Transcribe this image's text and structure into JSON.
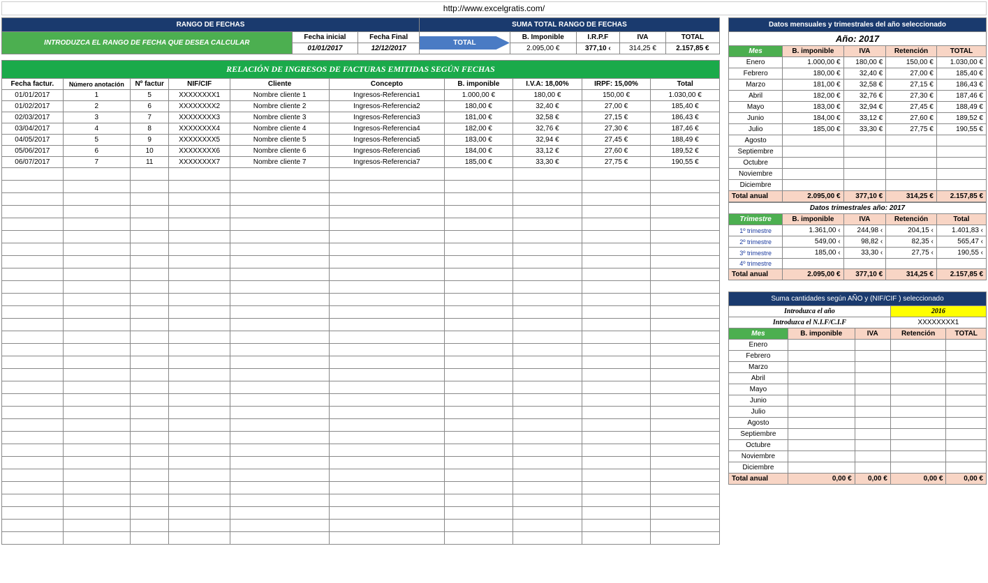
{
  "url": "http://www.excelgratis.com/",
  "rangeSection": {
    "title": "RANGO DE FECHAS",
    "instruction": "INTRODUZCA EL RANGO DE FECHA QUE DESEA CALCULAR",
    "startLabel": "Fecha inicial",
    "endLabel": "Fecha Final",
    "startDate": "01/01/2017",
    "endDate": "12/12/2017",
    "totalLabel": "TOTAL"
  },
  "sumaSection": {
    "title": "SUMA TOTAL RANGO DE FECHAS",
    "headers": [
      "B. Imponible",
      "I.R.P.F",
      "IVA",
      "TOTAL"
    ],
    "values": [
      "2.095,00 €",
      "377,10 ‹",
      "314,25 €",
      "2.157,85 €"
    ]
  },
  "mainTable": {
    "title": "RELACIÓN DE INGRESOS DE FACTURAS EMITIDAS SEGÚN FECHAS",
    "headers": [
      "Fecha factur.",
      "Número anotación",
      "Nº factur",
      "NIF/CIF",
      "Cliente",
      "Concepto",
      "B. imponible",
      "I.V.A: 18,00%",
      "IRPF: 15,00%",
      "Total"
    ],
    "rows": [
      [
        "01/01/2017",
        "1",
        "5",
        "XXXXXXXX1",
        "Nombre cliente 1",
        "Ingresos-Referencia1",
        "1.000,00 €",
        "180,00 €",
        "150,00 €",
        "1.030,00 €"
      ],
      [
        "01/02/2017",
        "2",
        "6",
        "XXXXXXXX2",
        "Nombre cliente 2",
        "Ingresos-Referencia2",
        "180,00 €",
        "32,40 €",
        "27,00 €",
        "185,40 €"
      ],
      [
        "02/03/2017",
        "3",
        "7",
        "XXXXXXXX3",
        "Nombre cliente 3",
        "Ingresos-Referencia3",
        "181,00 €",
        "32,58 €",
        "27,15 €",
        "186,43 €"
      ],
      [
        "03/04/2017",
        "4",
        "8",
        "XXXXXXXX4",
        "Nombre cliente 4",
        "Ingresos-Referencia4",
        "182,00 €",
        "32,76 €",
        "27,30 €",
        "187,46 €"
      ],
      [
        "04/05/2017",
        "5",
        "9",
        "XXXXXXXX5",
        "Nombre cliente 5",
        "Ingresos-Referencia5",
        "183,00 €",
        "32,94 €",
        "27,45 €",
        "188,49 €"
      ],
      [
        "05/06/2017",
        "6",
        "10",
        "XXXXXXXX6",
        "Nombre cliente 6",
        "Ingresos-Referencia6",
        "184,00 €",
        "33,12 €",
        "27,60 €",
        "189,52 €"
      ],
      [
        "06/07/2017",
        "7",
        "11",
        "XXXXXXXX7",
        "Nombre cliente 7",
        "Ingresos-Referencia7",
        "185,00 €",
        "33,30 €",
        "27,75 €",
        "190,55 €"
      ]
    ],
    "emptyRows": 30
  },
  "monthlyPanel": {
    "title": "Datos mensuales y trimestrales del año seleccionado",
    "yearLabel": "Año:  2017",
    "headers": [
      "Mes",
      "B. imponible",
      "IVA",
      "Retención",
      "TOTAL"
    ],
    "rows": [
      [
        "Enero",
        "1.000,00 €",
        "180,00 €",
        "150,00 €",
        "1.030,00 €"
      ],
      [
        "Febrero",
        "180,00 €",
        "32,40 €",
        "27,00 €",
        "185,40 €"
      ],
      [
        "Marzo",
        "181,00 €",
        "32,58 €",
        "27,15 €",
        "186,43 €"
      ],
      [
        "Abril",
        "182,00 €",
        "32,76 €",
        "27,30 €",
        "187,46 €"
      ],
      [
        "Mayo",
        "183,00 €",
        "32,94 €",
        "27,45 €",
        "188,49 €"
      ],
      [
        "Junio",
        "184,00 €",
        "33,12 €",
        "27,60 €",
        "189,52 €"
      ],
      [
        "Julio",
        "185,00 €",
        "33,30 €",
        "27,75 €",
        "190,55 €"
      ],
      [
        "Agosto",
        "",
        "",
        "",
        ""
      ],
      [
        "Septiembre",
        "",
        "",
        "",
        ""
      ],
      [
        "Octubre",
        "",
        "",
        "",
        ""
      ],
      [
        "Noviembre",
        "",
        "",
        "",
        ""
      ],
      [
        "Diciembre",
        "",
        "",
        "",
        ""
      ]
    ],
    "totalLabel": "Total anual",
    "totals": [
      "2.095,00 €",
      "377,10 €",
      "314,25 €",
      "2.157,85 €"
    ]
  },
  "quarterlyPanel": {
    "title": "Datos trimestrales año: 2017",
    "headers": [
      "Trimestre",
      "B. imponible",
      "IVA",
      "Retención",
      "Total"
    ],
    "rows": [
      [
        "1º trimestre",
        "1.361,00 ‹",
        "244,98 ‹",
        "204,15 ‹",
        "1.401,83 ‹"
      ],
      [
        "2º trimestre",
        "549,00 ‹",
        "98,82 ‹",
        "82,35 ‹",
        "565,47 ‹"
      ],
      [
        "3º trimestre",
        "185,00 ‹",
        "33,30 ‹",
        "27,75 ‹",
        "190,55 ‹"
      ],
      [
        "4º trimestre",
        "",
        "",
        "",
        ""
      ]
    ],
    "totalLabel": "Total anual",
    "totals": [
      "2.095,00 €",
      "377,10 €",
      "314,25 €",
      "2.157,85 €"
    ]
  },
  "nifPanel": {
    "title": "Suma cantidades según AÑO y (NIF/CIF ) seleccionado",
    "yearLabel": "Introduzca el año",
    "yearValue": "2016",
    "nifLabel": "Introduzca el N.I.F/C.I.F",
    "nifValue": "XXXXXXXX1",
    "headers": [
      "Mes",
      "B. imponible",
      "IVA",
      "Retención",
      "TOTAL"
    ],
    "months": [
      "Enero",
      "Febrero",
      "Marzo",
      "Abril",
      "Mayo",
      "Junio",
      "Julio",
      "Agosto",
      "Septiembre",
      "Octubre",
      "Noviembre",
      "Diciembre"
    ],
    "totalLabel": "Total anual",
    "totals": [
      "0,00 €",
      "0,00 €",
      "0,00 €",
      "0,00 €"
    ]
  }
}
